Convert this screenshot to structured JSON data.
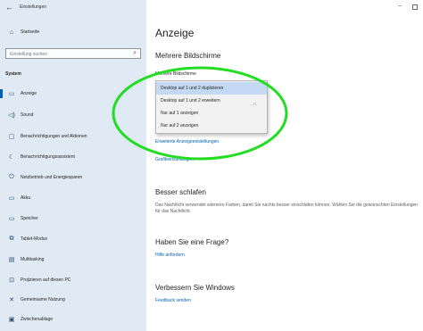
{
  "app": {
    "back_glyph": "←",
    "title": "Einstellungen",
    "minimize_glyph": "–"
  },
  "sidebar": {
    "home_label": "Startseite",
    "search_placeholder": "Einstellung suchen",
    "section_label": "System",
    "items": [
      {
        "label": "Anzeige",
        "icon": "monitor-icon",
        "glyph": "▭",
        "selected": true
      },
      {
        "label": "Sound",
        "icon": "speaker-icon",
        "glyph": "◁)"
      },
      {
        "label": "Benachrichtigungen und Aktionen",
        "icon": "message-icon",
        "glyph": "▢"
      },
      {
        "label": "Benachrichtigungsassistent",
        "icon": "moon-icon",
        "glyph": "☾"
      },
      {
        "label": "Netzbetrieb und Energiesparen",
        "icon": "power-icon",
        "glyph": "⏻"
      },
      {
        "label": "Akku",
        "icon": "battery-icon",
        "glyph": "▭"
      },
      {
        "label": "Speicher",
        "icon": "storage-icon",
        "glyph": "▭"
      },
      {
        "label": "Tablet-Modus",
        "icon": "tablet-icon",
        "glyph": "⧉"
      },
      {
        "label": "Multitasking",
        "icon": "multitasking-icon",
        "glyph": "▤"
      },
      {
        "label": "Projizieren auf diesen PC",
        "icon": "project-icon",
        "glyph": "⊡"
      },
      {
        "label": "Gemeinsame Nutzung",
        "icon": "share-icon",
        "glyph": "✕"
      },
      {
        "label": "Zwischenablage",
        "icon": "clipboard-icon",
        "glyph": "▣"
      }
    ]
  },
  "main": {
    "title": "Anzeige",
    "multi_display_heading": "Mehrere Bildschirme",
    "multi_display_label": "Mehrere Bildschirme",
    "dropdown_options": [
      {
        "label": "Desktop auf 1 und 2 duplizieren",
        "selected": true
      },
      {
        "label": "Desktop auf 1 und 2 erweitern"
      },
      {
        "label": "Nur auf 1 anzeigen"
      },
      {
        "label": "Nur auf 2 anzeigen"
      }
    ],
    "faded_text": "...n.",
    "advanced_link": "Erweiterte Anzeigeeinstellungen",
    "graphics_link": "Grafikeinstellungen",
    "sleep_heading": "Besser schlafen",
    "sleep_desc": "Das Nachtlicht verwendet wärmere Farben, damit Sie nachts besser einschlafen können. Wählen Sie die gewünschten Einstellungen für das Nachtlicht.",
    "question_heading": "Haben Sie eine Frage?",
    "help_link": "Hilfe anfordern",
    "improve_heading": "Verbessern Sie Windows",
    "feedback_link": "Feedback senden"
  },
  "colors": {
    "sidebar_bg": "#dfeaf4",
    "accent": "#0063b1",
    "annotation_ellipse": "#22dd22"
  }
}
